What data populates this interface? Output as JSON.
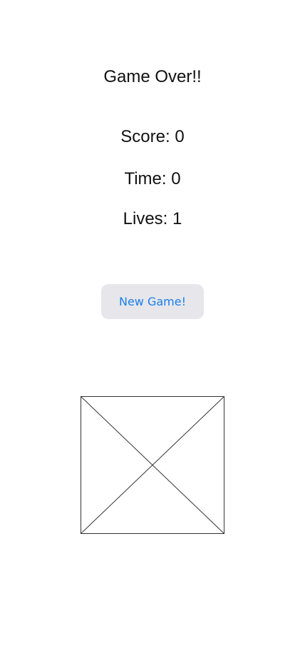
{
  "game_over": {
    "title": "Game Over!!",
    "score_text": "Score: 0",
    "time_text": "Time: 0",
    "lives_text": "Lives: 1",
    "new_game_label": "New Game!",
    "image_placeholder_icon": "image-placeholder-icon"
  },
  "colors": {
    "button_bg": "#e6e6eb",
    "button_text": "#1a7fe8",
    "text": "#111111"
  }
}
